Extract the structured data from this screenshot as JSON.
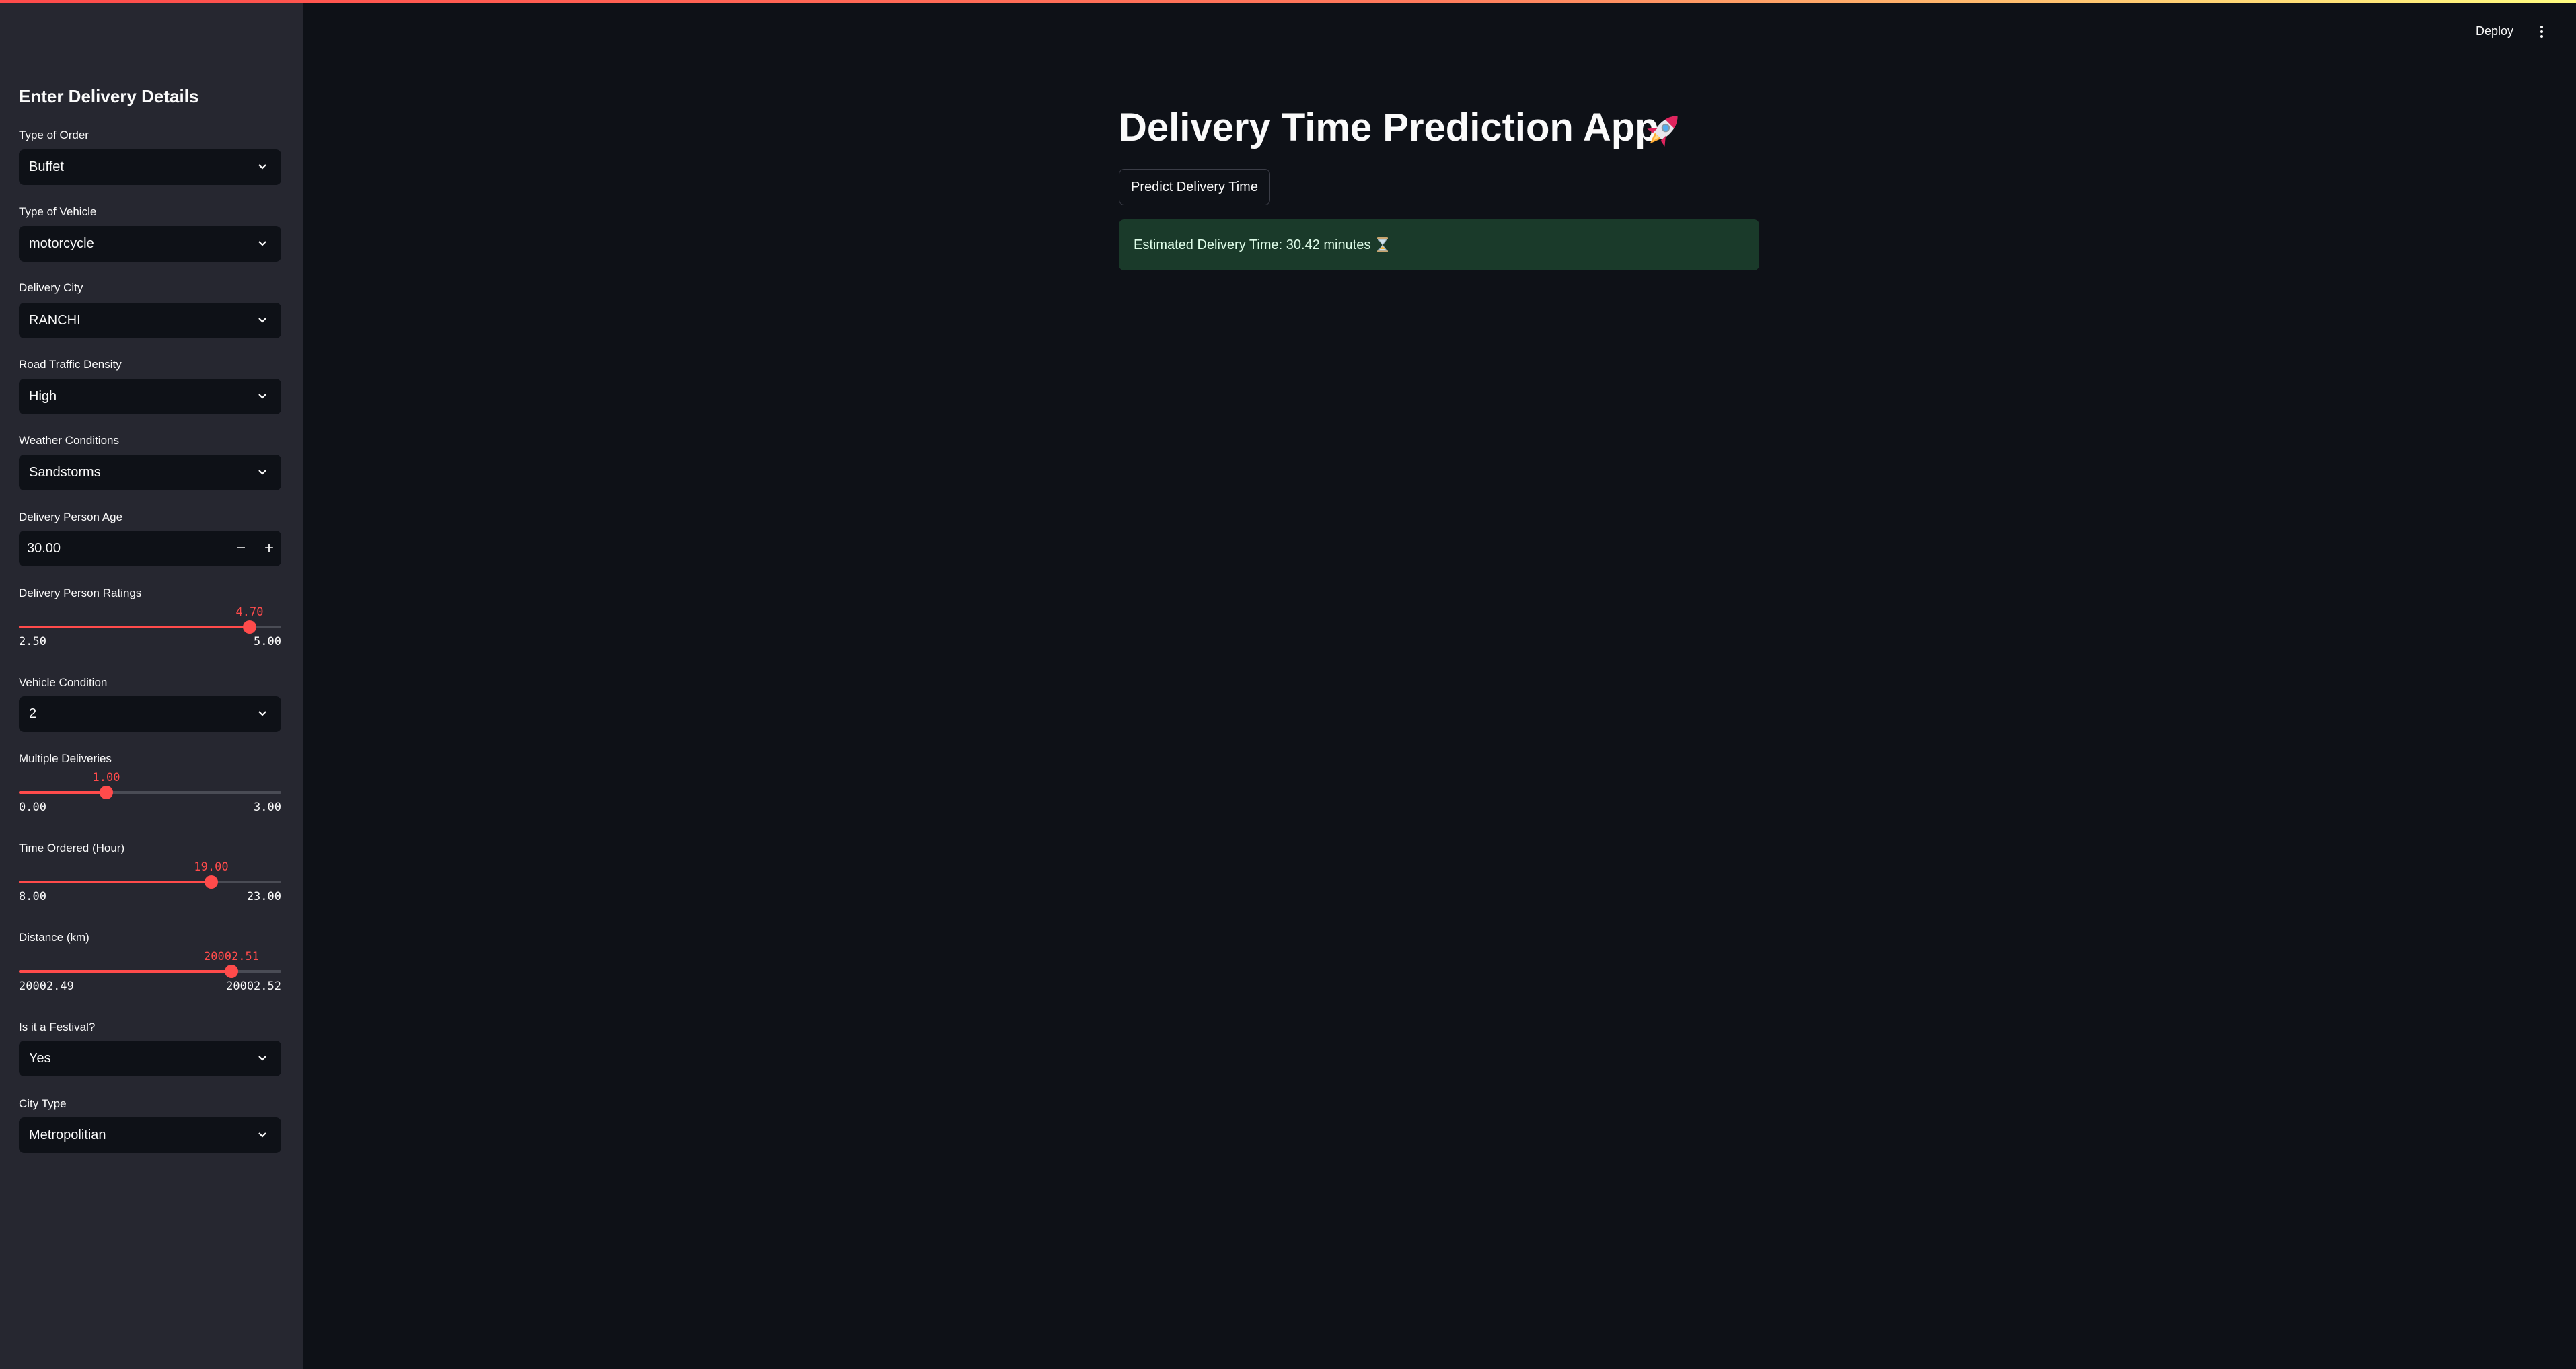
{
  "header": {
    "deploy_label": "Deploy",
    "menu_icon": "kebab-menu-icon"
  },
  "sidebar": {
    "title": "Enter Delivery Details",
    "type_of_order": {
      "label": "Type of Order",
      "value": "Buffet"
    },
    "type_of_vehicle": {
      "label": "Type of Vehicle",
      "value": "motorcycle"
    },
    "delivery_city": {
      "label": "Delivery City",
      "value": "RANCHI"
    },
    "road_traffic_density": {
      "label": "Road Traffic Density",
      "value": "High"
    },
    "weather_conditions": {
      "label": "Weather Conditions",
      "value": "Sandstorms"
    },
    "delivery_person_age": {
      "label": "Delivery Person Age",
      "value": "30.00",
      "minus": "−",
      "plus": "+"
    },
    "delivery_person_ratings": {
      "label": "Delivery Person Ratings",
      "value": "4.70",
      "min": "2.50",
      "max": "5.00",
      "fraction": 0.88
    },
    "vehicle_condition": {
      "label": "Vehicle Condition",
      "value": "2"
    },
    "multiple_deliveries": {
      "label": "Multiple Deliveries",
      "value": "1.00",
      "min": "0.00",
      "max": "3.00",
      "fraction": 0.333
    },
    "time_ordered": {
      "label": "Time Ordered (Hour)",
      "value": "19.00",
      "min": "8.00",
      "max": "23.00",
      "fraction": 0.733
    },
    "distance": {
      "label": "Distance (km)",
      "value": "20002.51",
      "min": "20002.49",
      "max": "20002.52",
      "fraction": 0.81
    },
    "is_festival": {
      "label": "Is it a Festival?",
      "value": "Yes"
    },
    "city_type": {
      "label": "City Type",
      "value": "Metropolitian"
    }
  },
  "main": {
    "title": "Delivery Time Prediction App",
    "title_icon": "rocket-icon",
    "predict_button": "Predict Delivery Time",
    "result_text": "Estimated Delivery Time: 30.42 minutes",
    "result_icon": "hourglass-icon"
  },
  "colors": {
    "accent": "#ff4b4b",
    "background": "#0e1117",
    "sidebar": "#262730",
    "success_bg": "#1a3a2a"
  }
}
